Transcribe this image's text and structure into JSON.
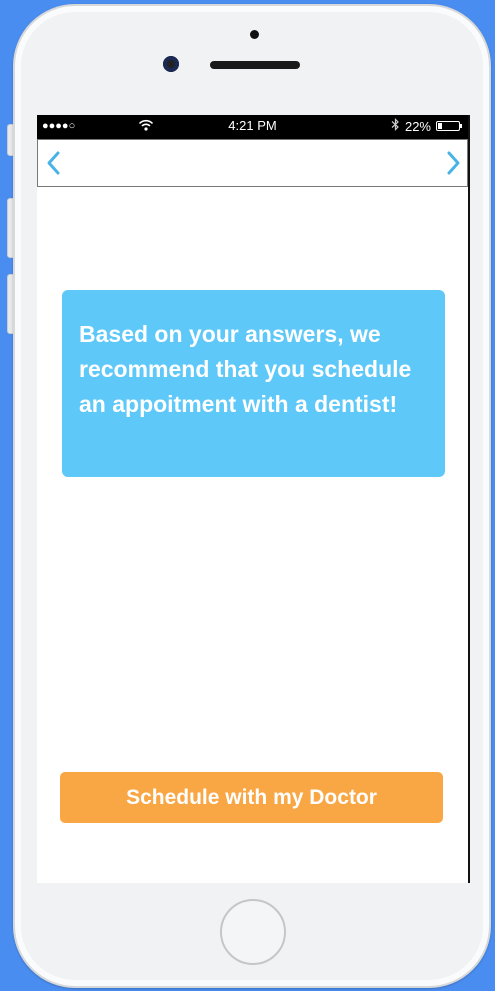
{
  "status_bar": {
    "signal": "●●●●○",
    "time": "4:21 PM",
    "battery_text": "22%",
    "battery_level": 0.22
  },
  "nav": {
    "back_icon": "chevron-left-icon",
    "forward_icon": "chevron-right-icon",
    "accent_color": "#4ab3e6"
  },
  "recommendation": {
    "message": "Based on your answers, we recommend that you schedule an appoitment with a dentist!",
    "background_color": "#5ec8f8"
  },
  "actions": {
    "schedule_label": "Schedule with my Doctor",
    "button_color": "#f9a744"
  }
}
